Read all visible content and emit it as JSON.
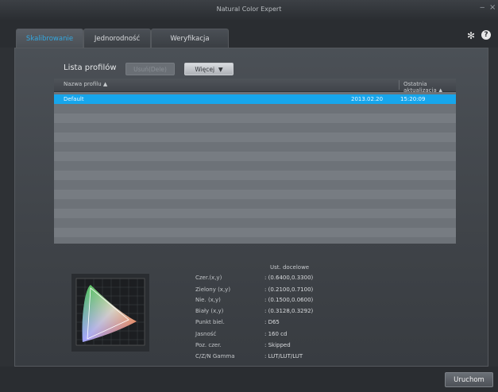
{
  "app": {
    "title": "Natural Color Expert"
  },
  "tabs": [
    {
      "label": "Skalibrowanie"
    },
    {
      "label": "Jednorodność"
    },
    {
      "label": "Weryfikacja"
    }
  ],
  "profiles": {
    "section_title": "Lista profilów",
    "delete_label": "Usuń(Dele)",
    "more_label": "Więcej",
    "columns": {
      "name": "Nazwa profilu",
      "updated": "Ostatnia aktualizacja"
    },
    "rows": [
      {
        "name": "Default",
        "date": "2013.02.20",
        "time": "15:20:09"
      }
    ]
  },
  "targets": {
    "title": "Ust. docelowe",
    "items": [
      {
        "label": "Czer.(x,y)",
        "value": ": (0.6400,0.3300)"
      },
      {
        "label": "Zielony (x,y)",
        "value": ": (0.2100,0.7100)"
      },
      {
        "label": "Nie. (x,y)",
        "value": ": (0.1500,0.0600)"
      },
      {
        "label": "Biały (x,y)",
        "value": ": (0.3128,0.3292)"
      },
      {
        "label": "Punkt biel.",
        "value": ": D65"
      },
      {
        "label": "Jasność",
        "value": ": 160 cd"
      },
      {
        "label": "Poz. czer.",
        "value": ": Skipped"
      },
      {
        "label": "C/Z/N Gamma",
        "value": ": LUT/LUT/LUT"
      }
    ]
  },
  "actions": {
    "run_label": "Uruchom"
  },
  "colors": {
    "accent": "#35a8e0",
    "selection": "#17a6ec"
  }
}
